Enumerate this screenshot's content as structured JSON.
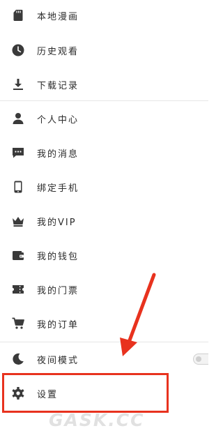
{
  "menu": {
    "items": [
      {
        "label": "本地漫画",
        "icon": "sd-card-icon"
      },
      {
        "label": "历史观看",
        "icon": "clock-icon"
      },
      {
        "label": "下载记录",
        "icon": "download-icon"
      },
      {
        "label": "个人中心",
        "icon": "person-icon"
      },
      {
        "label": "我的消息",
        "icon": "message-icon"
      },
      {
        "label": "绑定手机",
        "icon": "phone-icon"
      },
      {
        "label": "我的VIP",
        "icon": "crown-icon"
      },
      {
        "label": "我的钱包",
        "icon": "wallet-icon"
      },
      {
        "label": "我的门票",
        "icon": "ticket-icon"
      },
      {
        "label": "我的订单",
        "icon": "cart-icon"
      },
      {
        "label": "夜间模式",
        "icon": "moon-icon"
      },
      {
        "label": "设置",
        "icon": "gear-icon"
      }
    ]
  },
  "night_mode": {
    "enabled": false
  },
  "watermark": {
    "text": "GASK.CC"
  },
  "colors": {
    "icon": "#3a3a3a",
    "text": "#2b2b2b",
    "highlight": "#e8321e",
    "divider": "#e6e6e6"
  }
}
